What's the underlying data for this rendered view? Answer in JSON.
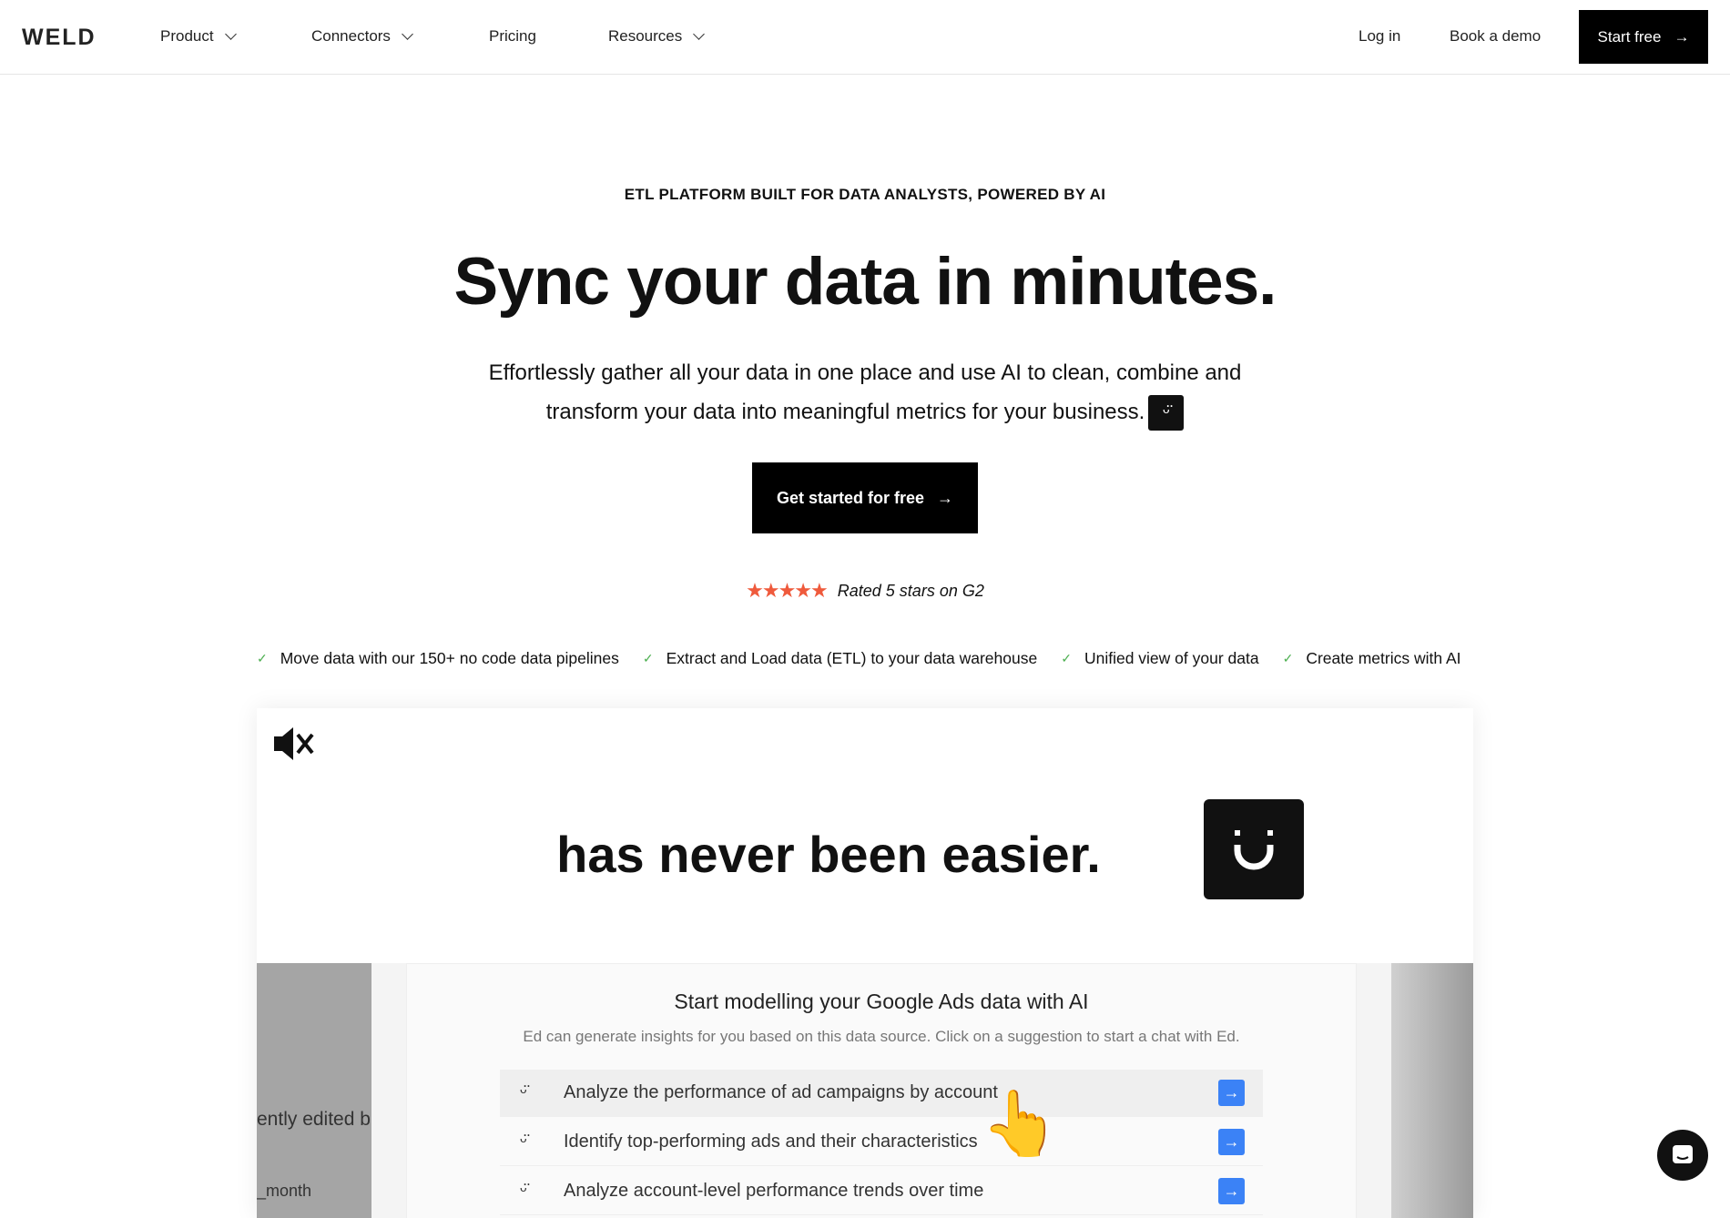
{
  "nav": {
    "logo": "WELD",
    "items": [
      {
        "label": "Product",
        "dropdown": true
      },
      {
        "label": "Connectors",
        "dropdown": true
      },
      {
        "label": "Pricing",
        "dropdown": false
      },
      {
        "label": "Resources",
        "dropdown": true
      }
    ],
    "login": "Log in",
    "demo": "Book a demo",
    "start": "Start free"
  },
  "hero": {
    "eyebrow": "ETL PLATFORM BUILT FOR DATA ANALYSTS, POWERED BY AI",
    "title": "Sync your data in minutes.",
    "lead_line1": "Effortlessly gather all your data in one place and use AI to clean, combine and",
    "lead_line2": "transform your data into meaningful metrics for your business.",
    "cta": "Get started for free",
    "stars": 5,
    "rating": "Rated 5 stars on G2",
    "star_color": "#ef5a3c"
  },
  "features": [
    "Move data with our 150+ no code data pipelines",
    "Extract and Load data (ETL) to your data warehouse",
    "Unified view of your data",
    "Create metrics with AI"
  ],
  "video": {
    "tagline": "has never been easier.",
    "left_text1": "ently edited b",
    "left_text2": "_month",
    "panel_title": "Start modelling your Google Ads data with AI",
    "panel_sub": "Ed can generate insights for you based on this data source. Click on a suggestion to start a chat with Ed.",
    "suggestions": [
      "Analyze the performance of ad campaigns by account",
      "Identify top-performing ads and their characteristics",
      "Analyze account-level performance trends over time"
    ],
    "accent": "#3b82f6"
  }
}
